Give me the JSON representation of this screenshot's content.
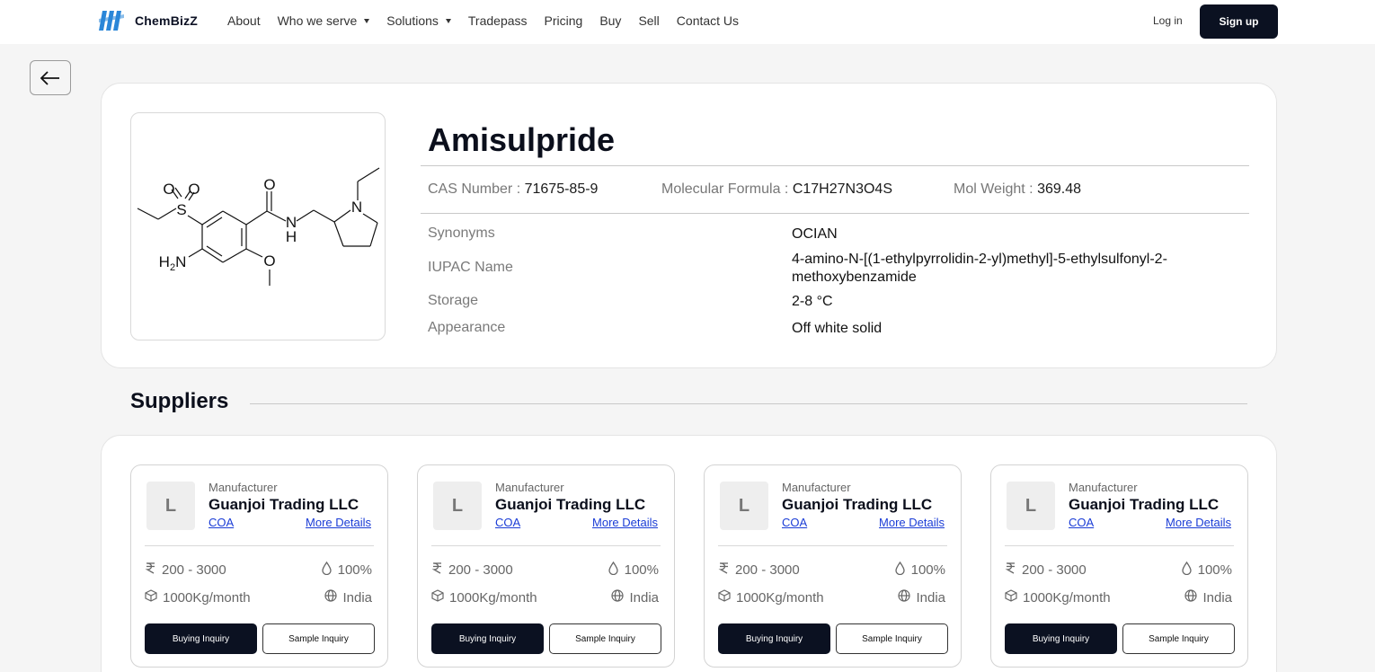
{
  "nav": {
    "brand": "ChemBizZ",
    "links": [
      {
        "label": "About",
        "dropdown": false
      },
      {
        "label": "Who we serve",
        "dropdown": true
      },
      {
        "label": "Solutions",
        "dropdown": true
      },
      {
        "label": "Tradepass",
        "dropdown": false
      },
      {
        "label": "Pricing",
        "dropdown": false
      },
      {
        "label": "Buy",
        "dropdown": false
      },
      {
        "label": "Sell",
        "dropdown": false
      },
      {
        "label": "Contact Us",
        "dropdown": false
      }
    ],
    "login": "Log in",
    "signup": "Sign up"
  },
  "product": {
    "name": "Amisulpride",
    "structure_labels": {
      "so2_o1": "O",
      "so2_o2": "O",
      "s": "S",
      "carbonyl_o": "O",
      "nh_n": "N",
      "nh_h": "H",
      "ring_n": "N",
      "amine": "H2N",
      "methoxy_o": "O"
    },
    "cas_label": "CAS Number : ",
    "cas_value": "71675-85-9",
    "formula_label": "Molecular Formula : ",
    "formula_value": "C17H27N3O4S",
    "weight_label": "Mol Weight : ",
    "weight_value": "369.48",
    "properties": [
      {
        "label": "Synonyms",
        "value": "OCIAN"
      },
      {
        "label": "IUPAC Name",
        "value": "4-amino-N-[(1-ethylpyrrolidin-2-yl)methyl]-5-ethylsulfonyl-2-methoxybenzamide"
      },
      {
        "label": "Storage",
        "value": "2-8  °C"
      },
      {
        "label": "Appearance",
        "value": "Off white solid"
      }
    ]
  },
  "suppliers": {
    "heading": "Suppliers",
    "cards": [
      {
        "avatar": "L",
        "role": "Manufacturer",
        "company": "Guanjoi Trading LLC",
        "coa": "COA",
        "more": "More Details",
        "price": "200 - 3000",
        "purity": "100%",
        "capacity": "1000Kg/month",
        "country": "India",
        "buy": "Buying Inquiry",
        "sample": "Sample Inquiry"
      },
      {
        "avatar": "L",
        "role": "Manufacturer",
        "company": "Guanjoi Trading LLC",
        "coa": "COA",
        "more": "More Details",
        "price": "200 - 3000",
        "purity": "100%",
        "capacity": "1000Kg/month",
        "country": "India",
        "buy": "Buying Inquiry",
        "sample": "Sample Inquiry"
      },
      {
        "avatar": "L",
        "role": "Manufacturer",
        "company": "Guanjoi Trading LLC",
        "coa": "COA",
        "more": "More Details",
        "price": "200 - 3000",
        "purity": "100%",
        "capacity": "1000Kg/month",
        "country": "India",
        "buy": "Buying Inquiry",
        "sample": "Sample Inquiry"
      },
      {
        "avatar": "L",
        "role": "Manufacturer",
        "company": "Guanjoi Trading LLC",
        "coa": "COA",
        "more": "More Details",
        "price": "200 - 3000",
        "purity": "100%",
        "capacity": "1000Kg/month",
        "country": "India",
        "buy": "Buying Inquiry",
        "sample": "Sample Inquiry"
      }
    ]
  },
  "colors": {
    "primary": "#0b1121",
    "link": "#1a3cd6",
    "brand_logo": "#2a86d8"
  },
  "icons": {
    "logo": "chembizz-logo-icon",
    "back": "arrow-left-icon",
    "price": "rupee-icon",
    "purity": "droplet-icon",
    "capacity": "box-icon",
    "country": "globe-icon"
  }
}
